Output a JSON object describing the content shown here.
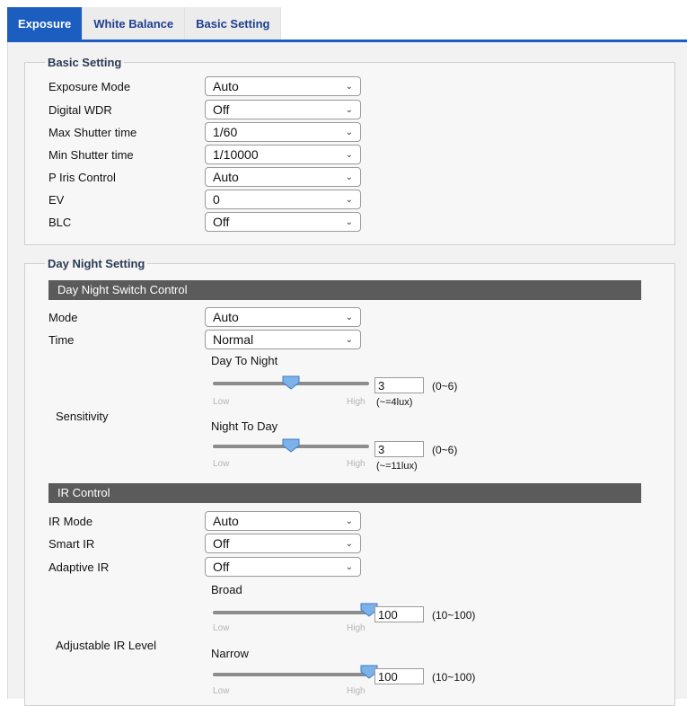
{
  "tabs": [
    {
      "label": "Exposure",
      "active": true
    },
    {
      "label": "White Balance",
      "active": false
    },
    {
      "label": "Basic Setting",
      "active": false
    }
  ],
  "basic_setting": {
    "legend": "Basic Setting",
    "rows": [
      {
        "label": "Exposure Mode",
        "value": "Auto"
      },
      {
        "label": "Digital WDR",
        "value": "Off"
      },
      {
        "label": "Max Shutter time",
        "value": "1/60"
      },
      {
        "label": "Min Shutter time",
        "value": "1/10000"
      },
      {
        "label": "P Iris Control",
        "value": "Auto"
      },
      {
        "label": "EV",
        "value": "0"
      },
      {
        "label": "BLC",
        "value": "Off"
      }
    ]
  },
  "day_night": {
    "legend": "Day Night Setting",
    "switch_header": "Day Night Switch Control",
    "mode": {
      "label": "Mode",
      "value": "Auto"
    },
    "time": {
      "label": "Time",
      "value": "Normal"
    },
    "sensitivity": {
      "label": "Sensitivity",
      "day_to_night": {
        "title": "Day To Night",
        "value": "3",
        "range": "(0~6)",
        "lux": "(~=4lux)",
        "fraction": 0.5
      },
      "night_to_day": {
        "title": "Night To Day",
        "value": "3",
        "range": "(0~6)",
        "lux": "(~=11lux)",
        "fraction": 0.5
      }
    },
    "low_label": "Low",
    "high_label": "High"
  },
  "ir_control": {
    "header": "IR Control",
    "ir_mode": {
      "label": "IR Mode",
      "value": "Auto"
    },
    "smart_ir": {
      "label": "Smart IR",
      "value": "Off"
    },
    "adaptive_ir": {
      "label": "Adaptive IR",
      "value": "Off"
    },
    "adjustable": {
      "label": "Adjustable IR Level",
      "broad": {
        "title": "Broad",
        "value": "100",
        "range": "(10~100)",
        "fraction": 1.0
      },
      "narrow": {
        "title": "Narrow",
        "value": "100",
        "range": "(10~100)",
        "fraction": 1.0
      }
    }
  },
  "colors": {
    "accent": "#1b5ec0",
    "section_bar": "#5b5b5b",
    "slider_handle": "#6fa8e6"
  },
  "icons": {
    "select_arrow": "chevron-down-icon",
    "slider_handle": "slider-handle-icon"
  }
}
